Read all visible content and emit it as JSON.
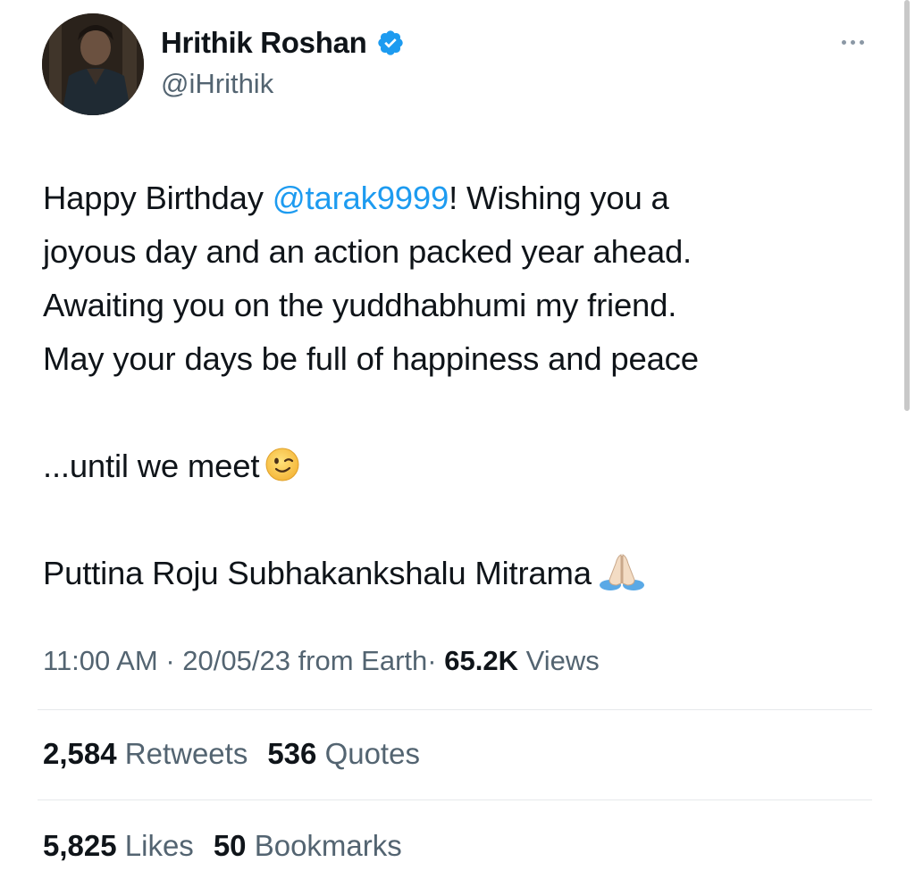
{
  "author": {
    "name": "Hrithik Roshan",
    "handle": "@iHrithik",
    "verified": true
  },
  "tweet": {
    "line1_pre": "Happy Birthday ",
    "mention": "@tarak9999",
    "line1_post": "! Wishing you a",
    "line2": "joyous day and an action packed year ahead.",
    "line3": "Awaiting you on the yuddhabhumi my friend.",
    "line4": "May your days be full of happiness and peace",
    "line5": "...until we meet",
    "line5_emoji": "winking-face",
    "line6": "Puttina Roju Subhakankshalu Mitrama",
    "line6_emoji": "folded-hands"
  },
  "meta": {
    "time": "11:00 AM",
    "date": "20/05/23",
    "source": "from Earth",
    "separator": "·",
    "views_count": "65.2K",
    "views_label": "Views"
  },
  "stats": {
    "retweets_count": "2,584",
    "retweets_label": "Retweets",
    "quotes_count": "536",
    "quotes_label": "Quotes",
    "likes_count": "5,825",
    "likes_label": "Likes",
    "bookmarks_count": "50",
    "bookmarks_label": "Bookmarks"
  },
  "colors": {
    "accent": "#1d9bf0",
    "text": "#0f1419",
    "muted": "#536471",
    "divider": "#e6e9eb"
  },
  "icons": {
    "verified": "verified-badge-icon",
    "more": "more-icon"
  }
}
